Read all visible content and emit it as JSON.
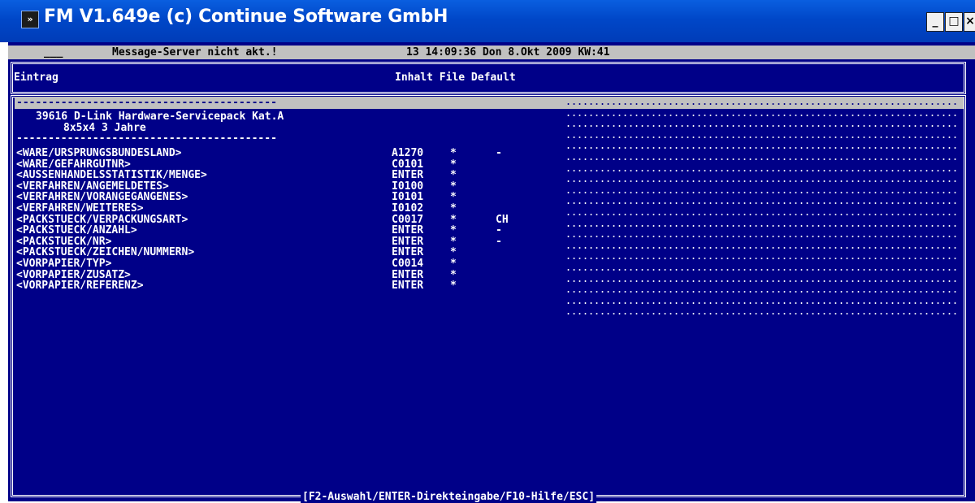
{
  "window": {
    "title": "FM V1.649e (c) Continue Software GmbH",
    "icon_glyph": "»",
    "min_label": "_",
    "max_label": "□",
    "close_label": "×"
  },
  "status": {
    "left": "___",
    "message": "Message-Server nicht akt.!",
    "datetime": "13 14:09:36 Don 8.Okt 2009 KW:41"
  },
  "header": {
    "entry": "Eintrag",
    "content_cols": "Inhalt File Default"
  },
  "separator": "-----------------------------------------",
  "article": {
    "line1": "39616 D-Link Hardware-Servicepack Kat.A",
    "line2": "8x5x4 3 Jahre"
  },
  "rows": [
    {
      "name": "<WARE/URSPRUNGSBUNDESLAND>",
      "value": "A1270",
      "file": "*",
      "default": "-"
    },
    {
      "name": "<WARE/GEFAHRGUTNR>",
      "value": "C0101",
      "file": "*",
      "default": ""
    },
    {
      "name": "<AUSSENHANDELSSTATISTIK/MENGE>",
      "value": "ENTER",
      "file": "*",
      "default": ""
    },
    {
      "name": "<VERFAHREN/ANGEMELDETES>",
      "value": "I0100",
      "file": "*",
      "default": ""
    },
    {
      "name": "<VERFAHREN/VORANGEGANGENES>",
      "value": "I0101",
      "file": "*",
      "default": ""
    },
    {
      "name": "<VERFAHREN/WEITERES>",
      "value": "I0102",
      "file": "*",
      "default": ""
    },
    {
      "name": "<PACKSTUECK/VERPACKUNGSART>",
      "value": "C0017",
      "file": "*",
      "default": "CH"
    },
    {
      "name": "<PACKSTUECK/ANZAHL>",
      "value": "ENTER",
      "file": "*",
      "default": "-"
    },
    {
      "name": "<PACKSTUECK/NR>",
      "value": "ENTER",
      "file": "*",
      "default": "-"
    },
    {
      "name": "<PACKSTUECK/ZEICHEN/NUMMERN>",
      "value": "ENTER",
      "file": "*",
      "default": ""
    },
    {
      "name": "<VORPAPIER/TYP>",
      "value": "C0014",
      "file": "*",
      "default": ""
    },
    {
      "name": "<VORPAPIER/ZUSATZ>",
      "value": "ENTER",
      "file": "*",
      "default": ""
    },
    {
      "name": "<VORPAPIER/REFERENZ>",
      "value": "ENTER",
      "file": "*",
      "default": ""
    }
  ],
  "footer": "[F2-Auswahl/ENTER-Direkteingabe/F10-Hilfe/ESC]"
}
